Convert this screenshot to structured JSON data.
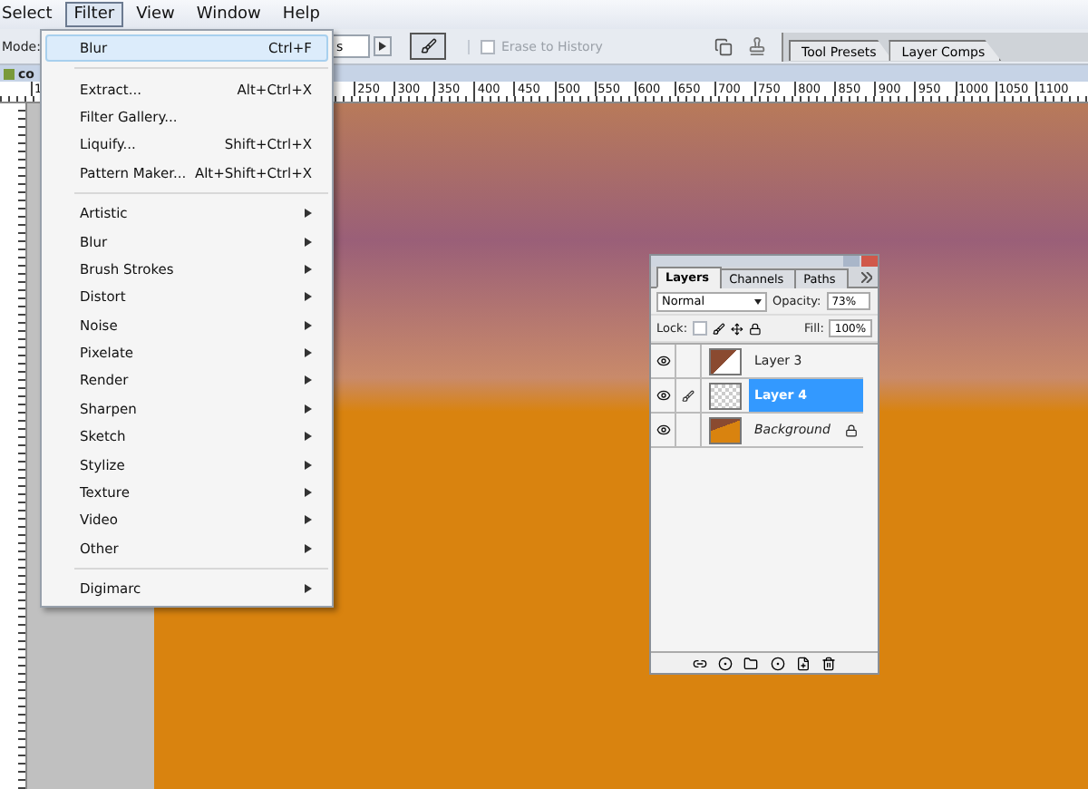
{
  "menubar": [
    {
      "label": "Select",
      "selected": false
    },
    {
      "label": "Filter",
      "selected": true
    },
    {
      "label": "View",
      "selected": false
    },
    {
      "label": "Window",
      "selected": false
    },
    {
      "label": "Help",
      "selected": false
    }
  ],
  "options_bar": {
    "mode_label": "Mode:",
    "field_fragment": "s",
    "erase_to_history": {
      "label": "Erase to History",
      "checked": false,
      "disabled": true
    }
  },
  "palette_well": {
    "tabs": [
      {
        "label": "Tool Presets"
      },
      {
        "label": "Layer Comps"
      }
    ]
  },
  "document": {
    "title": "co",
    "ruler_start": "1",
    "ruler_labels": [
      "250",
      "300",
      "350",
      "400",
      "450",
      "500",
      "550",
      "600",
      "650",
      "700",
      "750",
      "800",
      "850",
      "900",
      "950",
      "1000",
      "1050",
      "1100"
    ]
  },
  "filter_menu": {
    "items": [
      {
        "kind": "item",
        "label": "Blur",
        "shortcut": "Ctrl+F",
        "selected": true
      },
      {
        "kind": "separator"
      },
      {
        "kind": "item",
        "label": "Extract...",
        "shortcut": "Alt+Ctrl+X",
        "selected": false
      },
      {
        "kind": "item",
        "label": "Filter Gallery...",
        "selected": false
      },
      {
        "kind": "item",
        "label": "Liquify...",
        "shortcut": "Shift+Ctrl+X",
        "selected": false
      },
      {
        "kind": "item",
        "label": "Pattern Maker...",
        "shortcut": "Alt+Shift+Ctrl+X",
        "selected": false
      },
      {
        "kind": "separator"
      },
      {
        "kind": "submenu",
        "label": "Artistic",
        "selected": false
      },
      {
        "kind": "submenu",
        "label": "Blur",
        "selected": false
      },
      {
        "kind": "submenu",
        "label": "Brush Strokes",
        "selected": false
      },
      {
        "kind": "submenu",
        "label": "Distort",
        "selected": false
      },
      {
        "kind": "submenu",
        "label": "Noise",
        "selected": false
      },
      {
        "kind": "submenu",
        "label": "Pixelate",
        "selected": false
      },
      {
        "kind": "submenu",
        "label": "Render",
        "selected": false
      },
      {
        "kind": "submenu",
        "label": "Sharpen",
        "selected": false
      },
      {
        "kind": "submenu",
        "label": "Sketch",
        "selected": false
      },
      {
        "kind": "submenu",
        "label": "Stylize",
        "selected": false
      },
      {
        "kind": "submenu",
        "label": "Texture",
        "selected": false
      },
      {
        "kind": "submenu",
        "label": "Video",
        "selected": false
      },
      {
        "kind": "submenu",
        "label": "Other",
        "selected": false
      },
      {
        "kind": "separator"
      },
      {
        "kind": "submenu",
        "label": "Digimarc",
        "selected": false
      }
    ]
  },
  "layers_panel": {
    "tabs": [
      {
        "label": "Layers",
        "selected": true
      },
      {
        "label": "Channels",
        "selected": false
      },
      {
        "label": "Paths",
        "selected": false
      }
    ],
    "blend_mode": "Normal",
    "opacity_label": "Opacity:",
    "opacity": "73%",
    "lock_label": "Lock:",
    "fill_label": "Fill:",
    "fill": "100%",
    "layers": [
      {
        "kind": "image",
        "name": "Layer 3",
        "visible": true,
        "selected": false
      },
      {
        "kind": "empty",
        "name": "Layer 4",
        "visible": true,
        "selected": true
      },
      {
        "kind": "background",
        "name": "Background",
        "visible": true,
        "selected": false
      }
    ]
  }
}
